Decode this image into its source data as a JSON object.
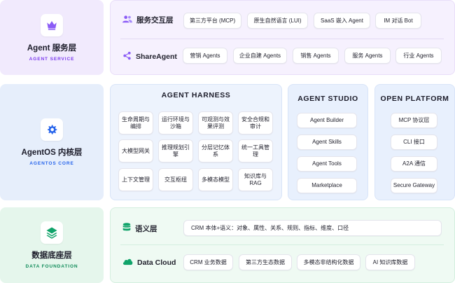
{
  "colors": {
    "top_bg": "#f1eafd",
    "mid_bg": "#e6eefb",
    "bottom_bg": "#e5f6ec",
    "purple": "#8b5cf6",
    "blue": "#2563eb",
    "green": "#10a36a"
  },
  "agent_service": {
    "title": "Agent 服务层",
    "subtitle": "AGENT SERVICE",
    "logo_icon": "crown-icon",
    "interaction": {
      "label": "服务交互层",
      "icon": "users-icon",
      "items": [
        "第三方平台 (MCP)",
        "原生自然语言 (LUI)",
        "SaaS 嵌入 Agent",
        "IM 对话 Bot"
      ]
    },
    "share": {
      "label": "ShareAgent",
      "icon": "share-icon",
      "items": [
        "营销 Agents",
        "企业自建 Agents",
        "销售 Agents",
        "服务 Agents",
        "行业 Agents"
      ]
    }
  },
  "agentos_core": {
    "title": "AgentOS 内核层",
    "subtitle": "AGENTOS CORE",
    "logo_icon": "gear-icon",
    "harness": {
      "title": "AGENT HARNESS",
      "items": [
        "生命周期与编排",
        "运行环境与沙箱",
        "可观测与效果评测",
        "安全合规和审计",
        "大模型网关",
        "推理规划引擎",
        "分层记忆体系",
        "统一工具管理",
        "上下文管理",
        "交互枢纽",
        "多模态模型",
        "知识库与RAG"
      ]
    },
    "studio": {
      "title": "AGENT STUDIO",
      "items": [
        "Agent Builder",
        "Agent Skills",
        "Agent Tools",
        "Marketplace"
      ]
    },
    "open_platform": {
      "title": "OPEN PLATFORM",
      "items": [
        "MCP 协议层",
        "CLI 接口",
        "A2A 通信",
        "Secure Gateway"
      ]
    }
  },
  "data_foundation": {
    "title": "数据底座层",
    "subtitle": "DATA FOUNDATION",
    "logo_icon": "layers-icon",
    "semantic": {
      "label": "语义层",
      "icon": "database-icon",
      "value": "CRM 本体+语义：对象、属性、关系、规则、指标、维度、口径"
    },
    "cloud": {
      "label": "Data Cloud",
      "icon": "cloud-icon",
      "items": [
        "CRM 业务数据",
        "第三方生态数据",
        "多模态非结构化数据",
        "AI 知识库数据"
      ]
    }
  }
}
